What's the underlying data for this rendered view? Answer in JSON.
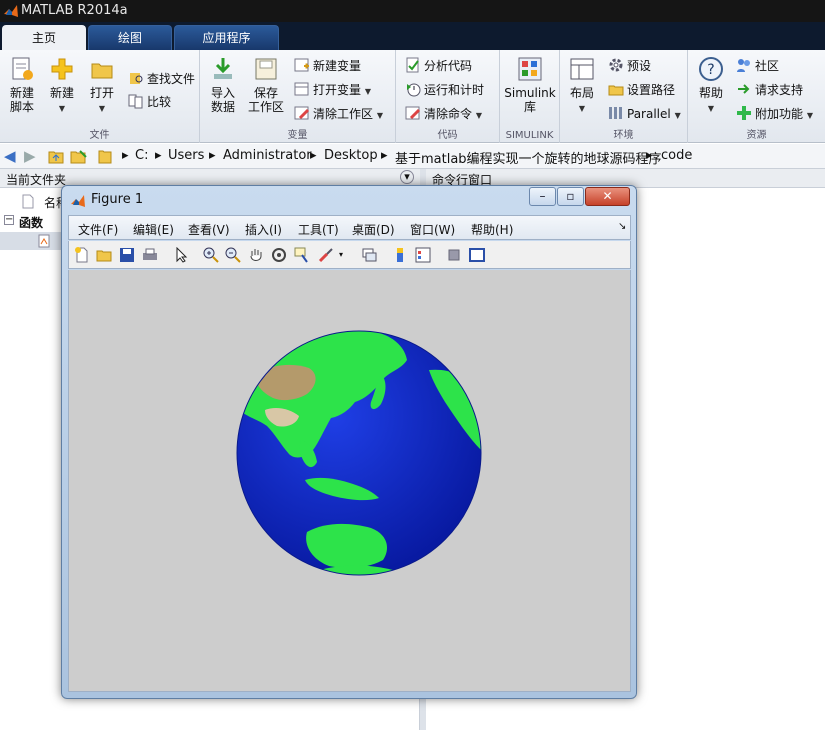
{
  "app": {
    "title": "MATLAB R2014a"
  },
  "tabs": [
    {
      "label": "主页"
    },
    {
      "label": "绘图"
    },
    {
      "label": "应用程序"
    }
  ],
  "ribbon": {
    "file": {
      "group": "文件",
      "new_script": "新建\n脚本",
      "new": "新建",
      "open": "打开",
      "find_files": "查找文件",
      "compare": "比较"
    },
    "variable": {
      "group": "变量",
      "import": "导入\n数据",
      "save_ws": "保存\n工作区",
      "new_var": "新建变量",
      "open_var": "打开变量",
      "clear_ws": "清除工作区"
    },
    "code": {
      "group": "代码",
      "analyze": "分析代码",
      "run_time": "运行和计时",
      "clear_cmd": "清除命令"
    },
    "simulink": {
      "group": "SIMULINK",
      "lib": "Simulink\n库"
    },
    "env": {
      "group": "环境",
      "layout": "布局",
      "prefs": "预设",
      "set_path": "设置路径",
      "parallel": "Parallel"
    },
    "resources": {
      "group": "资源",
      "help": "帮助",
      "community": "社区",
      "support": "请求支持",
      "addons": "附加功能"
    }
  },
  "address": {
    "segments": [
      "C:",
      "Users",
      "Administrator",
      "Desktop",
      "基于matlab编程实现一个旋转的地球源码程序",
      "code"
    ]
  },
  "panels": {
    "current_folder": "当前文件夹",
    "command_window": "命令行窗口",
    "name_col": "名称",
    "functions": "函数"
  },
  "figure": {
    "title": "Figure 1",
    "menu": [
      "文件(F)",
      "编辑(E)",
      "查看(V)",
      "插入(I)",
      "工具(T)",
      "桌面(D)",
      "窗口(W)",
      "帮助(H)"
    ],
    "win_min": "–",
    "win_max": "▫",
    "win_close": "✕"
  },
  "colors": {
    "land": "#2de34a",
    "ocean": "#0a2bd6",
    "desert": "#b49a6b",
    "canvas": "#cdcdcd"
  }
}
